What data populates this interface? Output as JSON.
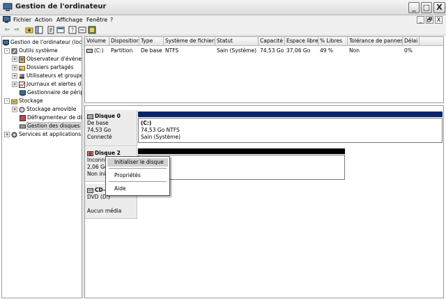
{
  "window": {
    "title": "Gestion de l'ordinateur",
    "minimize_label": "_",
    "maximize_label": "□",
    "close_label": "X"
  },
  "menubar": {
    "items": [
      "Fichier",
      "Action",
      "Affichage",
      "Fenêtre",
      "?"
    ],
    "mdi_buttons": [
      "_",
      "🗗",
      "X"
    ]
  },
  "toolbar": {
    "buttons": [
      "back-icon",
      "forward-icon",
      "up-icon",
      "show-tree-icon",
      "properties-icon",
      "help-icon",
      "export-icon",
      "settings-icon",
      "wizard-icon"
    ],
    "back_glyph": "⇦",
    "forward_glyph": "⇨"
  },
  "tree": {
    "root": "Gestion de l'ordinateur (local)",
    "items": [
      "Outils système",
      "Observateur d'événements",
      "Dossiers partagés",
      "Utilisateurs et groupes locaux",
      "Journaux et alertes de performance",
      "Gestionnaire de périphériques",
      "Stockage",
      "Stockage amovible",
      "Défragmenteur de disque",
      "Gestion des disques",
      "Services et applications"
    ],
    "expanders": [
      "-",
      "+",
      "+",
      "+",
      "+",
      "-",
      "+",
      "+"
    ]
  },
  "volume_list": {
    "columns": [
      "Volume",
      "Disposition",
      "Type",
      "Système de fichiers",
      "Statut",
      "Capacité",
      "Espace libre",
      "% Libres",
      "Tolérance de pannes",
      "Délai"
    ],
    "rows": [
      [
        "(C:)",
        "Partition",
        "De base",
        "NTFS",
        "Sain (Système)",
        "74,53 Go",
        "37,06 Go",
        "49 %",
        "Non",
        "0%"
      ]
    ]
  },
  "disks": [
    {
      "name": "Disque 0",
      "type": "De base",
      "size": "74,53 Go",
      "status": "Connecté",
      "partition": {
        "name": "(C:)",
        "detail": "74,53 Go NTFS",
        "status": "Sain (Système)"
      },
      "bar_color": "#0a246a"
    },
    {
      "name": "Disque 2",
      "type": "Inconnu",
      "size": "2,06 Go",
      "status": "Non initialisé",
      "bar_color": "#000000"
    },
    {
      "name": "CD-ROM 0",
      "type": "DVD (D:)",
      "status": "Aucun média"
    }
  ],
  "context_menu": {
    "items": [
      "Initialiser le disque",
      "Propriétés",
      "Aide"
    ]
  }
}
